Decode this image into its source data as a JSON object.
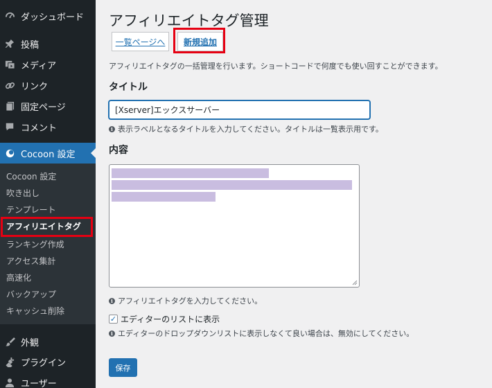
{
  "sidebar": {
    "top_items": [
      {
        "label": "ダッシュボード",
        "icon": "dashboard-icon"
      },
      {
        "label": "投稿",
        "icon": "pin-icon"
      },
      {
        "label": "メディア",
        "icon": "media-icon"
      },
      {
        "label": "リンク",
        "icon": "link-icon"
      },
      {
        "label": "固定ページ",
        "icon": "page-icon"
      },
      {
        "label": "コメント",
        "icon": "comment-icon"
      },
      {
        "label": "Cocoon 設定",
        "icon": "cocoon-icon"
      }
    ],
    "submenu": [
      "Cocoon 設定",
      "吹き出し",
      "テンプレート",
      "アフィリエイトタグ",
      "ランキング作成",
      "アクセス集計",
      "高速化",
      "バックアップ",
      "キャッシュ削除"
    ],
    "bottom_items": [
      {
        "label": "外観",
        "icon": "appearance-icon"
      },
      {
        "label": "プラグイン",
        "icon": "plugin-icon"
      },
      {
        "label": "ユーザー",
        "icon": "user-icon"
      }
    ],
    "active_color": "#2271b1",
    "highlight_color": "#e60012"
  },
  "main": {
    "title": "アフィリエイトタグ管理",
    "tabs": {
      "list": "一覧ページへ",
      "new": "新規追加"
    },
    "description": "アフィリエイトタグの一括管理を行います。ショートコードで何度でも使い回すことができます。",
    "title_section": "タイトル",
    "title_value": "[Xserver]エックスサーバー",
    "title_hint": "表示ラベルとなるタイトルを入力してください。タイトルは一覧表示用です。",
    "content_section": "内容",
    "content_hint": "アフィリエイトタグを入力してください。",
    "checkbox_label": "エディターのリストに表示",
    "checkbox_checked": true,
    "checkbox_hint": "エディターのドロップダウンリストに表示しなくて良い場合は、無効にしてください。",
    "save_label": "保存"
  }
}
